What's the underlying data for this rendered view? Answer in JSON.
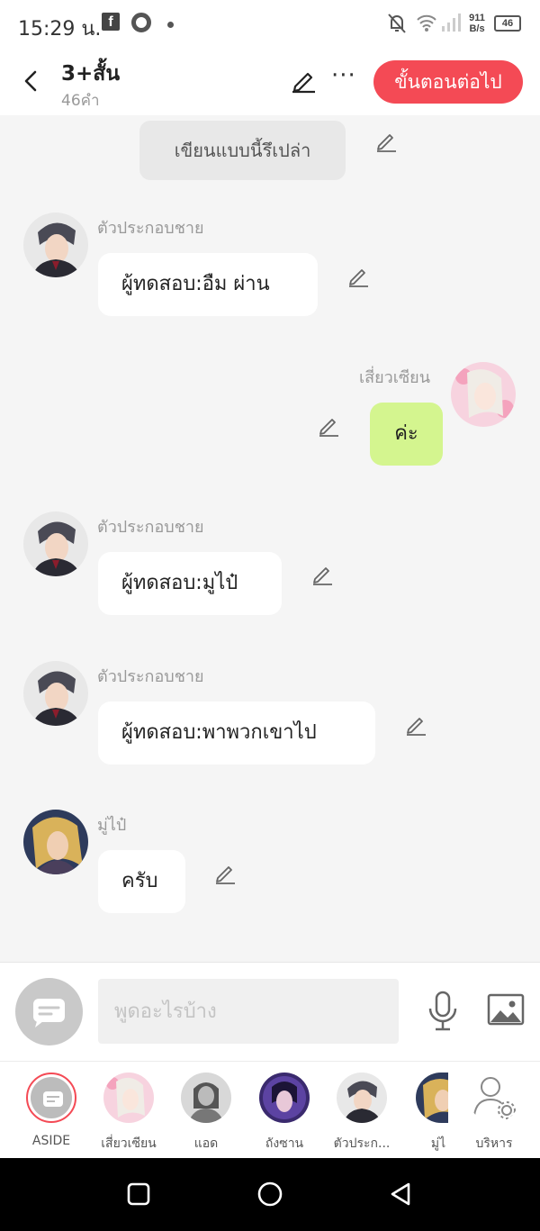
{
  "status_bar": {
    "time": "15:29 น.",
    "speed_value": "911",
    "speed_unit": "B/s",
    "battery": "46"
  },
  "header": {
    "title": "3+สั้น",
    "word_count": "46คำ",
    "next_button": "ขั้นตอนต่อไป"
  },
  "chat": {
    "system_message": "เขียนแบบนี้รึเปล่า",
    "messages": [
      {
        "sender": "ตัวประกอบชาย",
        "text": "ผู้ทดสอบ:อืม ผ่าน"
      },
      {
        "sender": "เสี่ยวเซียน",
        "text": "ค่ะ"
      },
      {
        "sender": "ตัวประกอบชาย",
        "text": "ผู้ทดสอบ:มูไป๋"
      },
      {
        "sender": "ตัวประกอบชาย",
        "text": "ผู้ทดสอบ:พาพวกเขาไป"
      },
      {
        "sender": "มู่ไป๋",
        "text": "ครับ"
      }
    ]
  },
  "input": {
    "placeholder": "พูดอะไรบ้าง"
  },
  "characters": [
    {
      "label": "ASIDE"
    },
    {
      "label": "เสี่ยวเซียน"
    },
    {
      "label": "แอด"
    },
    {
      "label": "ถังซาน"
    },
    {
      "label": "ตัวประก..."
    },
    {
      "label": "มู่ไ"
    },
    {
      "label": "บริหาร"
    }
  ],
  "colors": {
    "accent": "#f44a55",
    "own_bubble": "#d4f58f"
  }
}
